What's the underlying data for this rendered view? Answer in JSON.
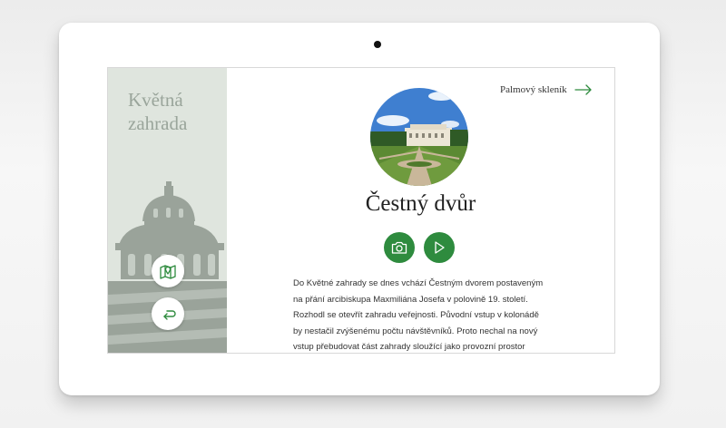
{
  "sidebar": {
    "title_line1": "Květná",
    "title_line2": "zahrada"
  },
  "navigation": {
    "next_label": "Palmový skleník"
  },
  "main": {
    "title": "Čestný dvůr",
    "description": "Do Květné zahrady se dnes vchází Čestným dvorem postaveným na přání arcibiskupa Maxmiliána Josefa v polovině 19. století. Rozhodl se otevřít zahradu veřejnosti. Původní vstup v kolonádě by nestačil zvýšenému počtu návštěvníků. Proto nechal na nový vstup přebudovat část zahrady sloužící jako provozní prostor zahradníků."
  },
  "icons": {
    "map": "map-pin-icon",
    "back": "return-arrow-icon",
    "next": "arrow-right-icon",
    "gallery": "camera-icon",
    "play": "play-icon"
  },
  "colors": {
    "accent": "#2e8b3e",
    "sidebar_bg": "#dfe5de",
    "sidebar_text": "#9aa59b"
  }
}
